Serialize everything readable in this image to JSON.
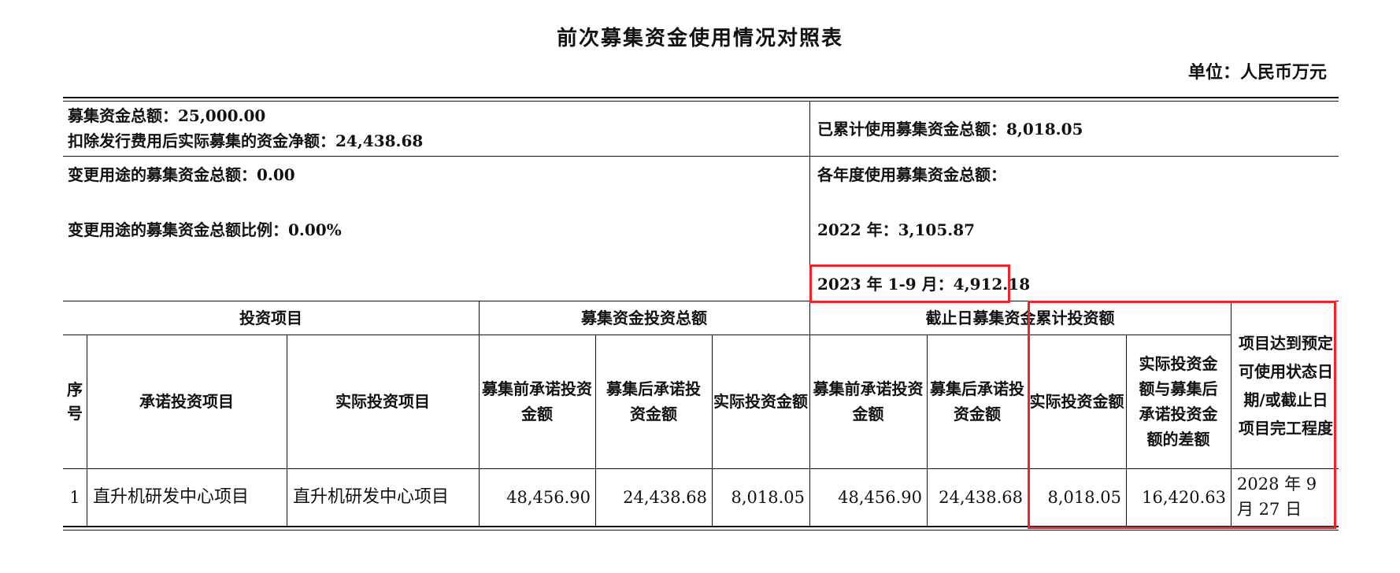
{
  "title": "前次募集资金使用情况对照表",
  "unit": "单位：人民币万元",
  "summary": {
    "total_raised": "募集资金总额：25,000.00",
    "net_raised": "扣除发行费用后实际募集的资金净额：24,438.68",
    "changed_total": "变更用途的募集资金总额：0.00",
    "changed_ratio": "变更用途的募集资金总额比例：0.00%",
    "cumulative_used": "已累计使用募集资金总额：8,018.05",
    "yearly_heading": "各年度使用募集资金总额：",
    "year_2022": "2022 年：3,105.87",
    "year_2023": "2023 年 1-9 月：4,912.18"
  },
  "header": {
    "group_project": "投资项目",
    "group_total": "募集资金投资总额",
    "group_cumulative": "截止日募集资金累计投资额",
    "completion": "项目达到预定可使用状态日期/或截止日项目完工程度",
    "seq": "序号",
    "committed_project": "承诺投资项目",
    "actual_project": "实际投资项目",
    "pre_commit": "募集前承诺投资金额",
    "post_commit": "募集后承诺投资金额",
    "actual_amount": "实际投资金额",
    "cum_pre_commit": "募集前承诺投资金额",
    "cum_post_commit": "募集后承诺投资金额",
    "cum_actual": "实际投资金额",
    "difference": "实际投资金额与募集后承诺投资金额的差额"
  },
  "rows": [
    {
      "seq": "1",
      "committed_project": "直升机研发中心项目",
      "actual_project": "直升机研发中心项目",
      "pre_commit": "48,456.90",
      "post_commit": "24,438.68",
      "actual_amount": "8,018.05",
      "cum_pre_commit": "48,456.90",
      "cum_post_commit": "24,438.68",
      "cum_actual": "8,018.05",
      "difference": "16,420.63",
      "completion": "2028 年 9 月 27 日"
    }
  ],
  "highlight_color": "#e8262b"
}
